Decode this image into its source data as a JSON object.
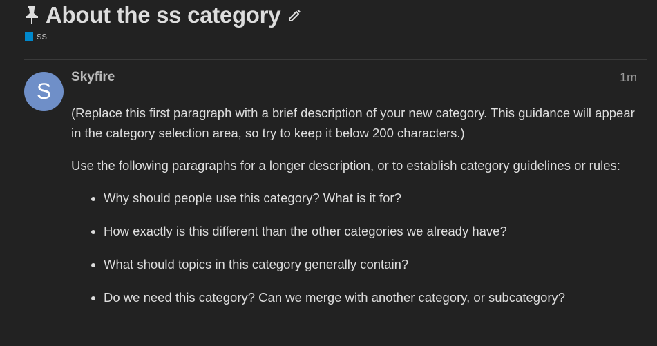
{
  "topic": {
    "title": "About the ss category",
    "category": {
      "name": "ss",
      "color": "#0088cc"
    },
    "pinned_icon": "pin-icon",
    "edit_icon": "pencil-icon"
  },
  "post": {
    "avatar_letter": "S",
    "avatar_color": "#6f8fc8",
    "username": "Skyfire",
    "date": "1m",
    "paragraphs": [
      "(Replace this first paragraph with a brief description of your new category. This guidance will appear in the category selection area, so try to keep it below 200 characters.)",
      "Use the following paragraphs for a longer description, or to establish category guidelines or rules:"
    ],
    "bullets": [
      "Why should people use this category? What is it for?",
      "How exactly is this different than the other categories we already have?",
      "What should topics in this category generally contain?",
      "Do we need this category? Can we merge with another category, or subcategory?"
    ]
  }
}
